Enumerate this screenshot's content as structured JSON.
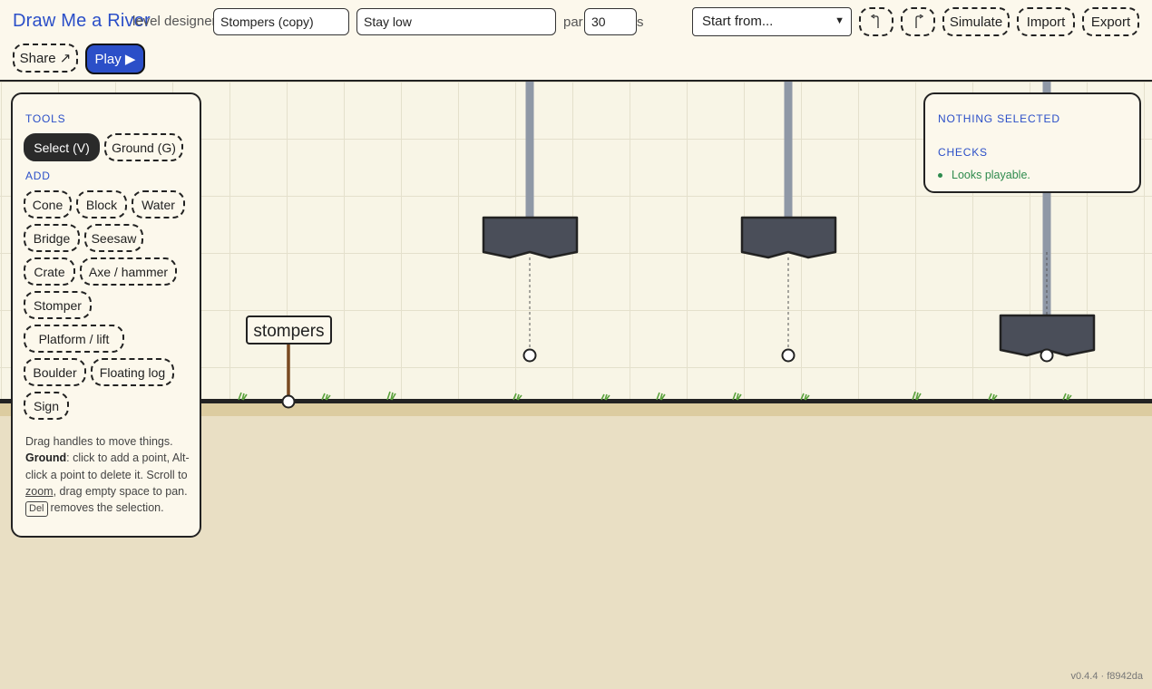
{
  "app": {
    "title": "Draw Me a River",
    "subtitle": "level designer"
  },
  "toolbar": {
    "level_name": "Stompers (copy)",
    "level_hint": "Stay low",
    "par_label": "par",
    "par_value": "30",
    "par_unit": "s",
    "start_from": "Start from...",
    "undo_icon": "undo-icon",
    "redo_icon": "redo-icon",
    "simulate_label": "Simulate",
    "import_label": "Import",
    "export_label": "Export",
    "share_label": "Share ↗",
    "play_label": "Play ▶"
  },
  "tools_panel": {
    "tools_title": "TOOLS",
    "tools": [
      "Select (V)",
      "Ground (G)"
    ],
    "active_tool": "Select (V)",
    "add_title": "ADD",
    "add_items": [
      "Cone",
      "Block",
      "Water",
      "Bridge",
      "Seesaw",
      "Crate",
      "Axe / hammer",
      "Stomper",
      "Platform / lift",
      "Boulder",
      "Floating log",
      "Sign"
    ],
    "help": {
      "line1": "Drag handles to move things.",
      "ground_word": "Ground",
      "line2": ": click to add a point, Alt-click a point to delete it. Scroll to",
      "zoom_word": "zoom",
      "line3": ", drag empty space to pan.",
      "del_key": "Del",
      "line4": "removes the selection."
    }
  },
  "inspector": {
    "selection_title": "NOTHING SELECTED",
    "checks_title": "CHECKS",
    "checks": [
      "Looks playable."
    ]
  },
  "scene": {
    "sign_text": "stompers",
    "stomper_count": 3
  },
  "colors": {
    "accent": "#2b4fc8",
    "ok": "#2e8b4e",
    "stomper": "#4a4e59",
    "rod": "#8f98a6",
    "ground": "#222222"
  },
  "version": "v0.4.4 · f8942da"
}
